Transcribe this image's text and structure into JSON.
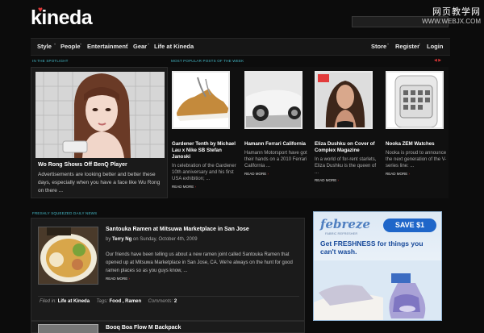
{
  "header": {
    "logo": "kineda",
    "watermark_cn": "网页教学网",
    "watermark_url": "WWW.WEBJX.COM"
  },
  "nav": {
    "left": [
      "Style",
      "People",
      "Entertainment",
      "Gear",
      "Life at Kineda"
    ],
    "right": [
      "Store",
      "Register",
      "Login"
    ]
  },
  "sections": {
    "spotlight": "IN THE SPOTLIGHT",
    "popular": "MOST POPULAR POSTS OF THE WEEK",
    "daily": "FRESHLY SQUEEZED DAILY NEWS"
  },
  "spotlight": {
    "title": "Wo Rong Shows Off BenQ Player",
    "excerpt": "Advertisements are looking better and better these days, especially when you have a face like Wu Rong on there ..."
  },
  "popular": [
    {
      "title": "Gardener Tenth by Michael Lau x Nike SB Stefan Janoski",
      "excerpt": "In celebration of the Gardener 10th anniversary and his first USA exhibition; ...",
      "read_more": "READ MORE",
      "thumb": "shoe"
    },
    {
      "title": "Hamann Ferrari California",
      "excerpt": "Hamann Motorsport have got their hands on a 2010 Ferrari California ...",
      "read_more": "READ MORE",
      "thumb": "car"
    },
    {
      "title": "Eliza Dushku on Cover of Complex Magazine",
      "excerpt": "In a world of for-rent starlets, Eliza Dushku is the queen of ...",
      "read_more": "READ MORE",
      "thumb": "magazine"
    },
    {
      "title": "Nooka ZEM Watches",
      "excerpt": "Nooka is proud to announce the next generation of the V-series line: ...",
      "read_more": "READ MORE",
      "thumb": "watch"
    }
  ],
  "news": {
    "title": "Santouka Ramen at Mitsuwa Marketplace in San Jose",
    "byline_prefix": "by",
    "author": "Terry Ng",
    "byline_date": "on Sunday, October 4th, 2009",
    "excerpt": "Our friends have been telling us about a new ramen joint called Santouka Ramen that opened up at Mitsuwa Marketplace in San Jose, CA. We're always on the hunt for good ramen places so as you guys know, ...",
    "read_more": "READ MORE",
    "filed_label": "Filed in:",
    "filed_value": "Life at Kineda",
    "tags_label": "Tags:",
    "tags_value": "Food , Ramen",
    "comments_label": "Comments:",
    "comments_value": "2"
  },
  "news2": {
    "title": "Booq Boa Flow M Backpack"
  },
  "ad": {
    "brand": "febreze",
    "brand_sub": "FABRIC REFRESHER",
    "save": "SAVE $1",
    "headline": "Get FRESHNESS for things you can't wash."
  },
  "colors": {
    "accent_cyan": "#44b8c6",
    "accent_red": "#d33333",
    "background": "#0c0c0c"
  }
}
